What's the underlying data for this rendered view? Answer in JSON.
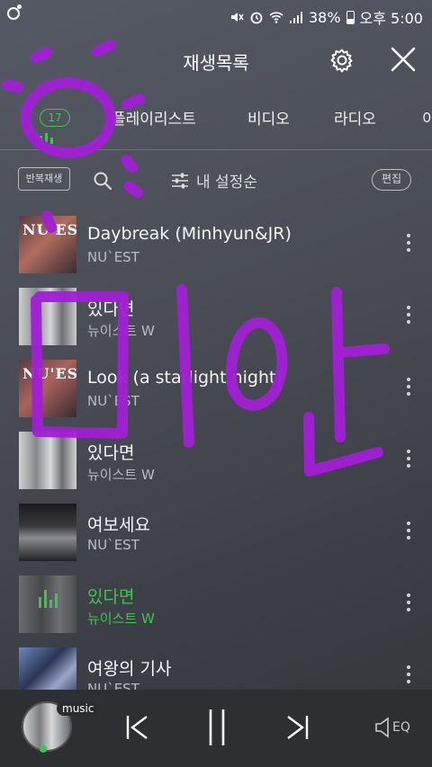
{
  "statusbar": {
    "battery": "38%",
    "time": "오후 5:00"
  },
  "header": {
    "title": "재생목록",
    "settings_icon": "gear-icon",
    "close_icon": "close-icon"
  },
  "tabs": {
    "now_count": "17",
    "items": [
      "플레이리스트",
      "비디오",
      "라디오",
      "이"
    ]
  },
  "toolbar": {
    "repeat_label": "반복재생",
    "sort_label": "내 설정순",
    "edit_label": "편집"
  },
  "songs": [
    {
      "title": "Daybreak (Minhyun&JR)",
      "artist": "NU`EST",
      "cover_text": "NU'EST"
    },
    {
      "title": "있다면",
      "artist": "뉴이스트 W",
      "cover_text": ""
    },
    {
      "title": "Look (a starlight night)",
      "artist": "NU`EST",
      "cover_text": "NU'EST"
    },
    {
      "title": "있다면",
      "artist": "뉴이스트 W",
      "cover_text": ""
    },
    {
      "title": "여보세요",
      "artist": "NU`EST",
      "cover_text": ""
    },
    {
      "title": "있다면",
      "artist": "뉴이스트 W",
      "cover_text": ""
    },
    {
      "title": "여왕의 기사",
      "artist": "NU`EST",
      "cover_text": ""
    }
  ],
  "playing_index": 5,
  "player": {
    "badge": "music",
    "eq_label": "EQ"
  },
  "colors": {
    "accent": "#3fc452",
    "doodle": "#a21fd6"
  }
}
